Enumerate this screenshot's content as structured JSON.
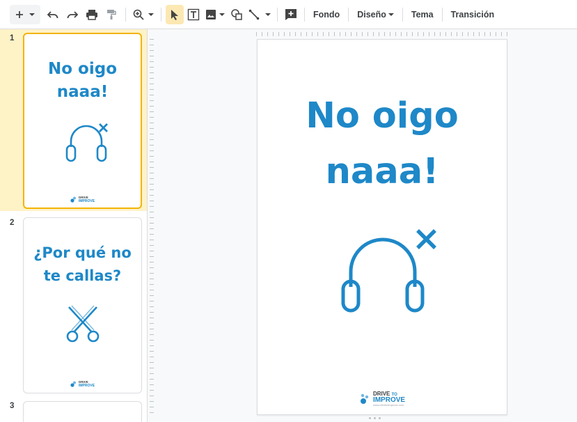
{
  "toolbar": {
    "new_icon": "plus-icon",
    "buttons": [
      "undo-icon",
      "redo-icon",
      "print-icon",
      "paint-format-icon",
      "zoom-icon",
      "select-icon",
      "textbox-icon",
      "image-icon",
      "shape-icon",
      "line-icon",
      "comment-icon"
    ],
    "fondo": "Fondo",
    "diseno": "Diseño",
    "tema": "Tema",
    "transicion": "Transición"
  },
  "slides": [
    {
      "number": "1",
      "title_line1": "No oigo",
      "title_line2": "naaa!",
      "icon": "headphones-icon"
    },
    {
      "number": "2",
      "title_line1": "¿Por qué no",
      "title_line2": "te callas?",
      "icon": "scissors-icon"
    },
    {
      "number": "3"
    }
  ],
  "main_slide": {
    "title_line1": "No oigo",
    "title_line2": "naaa!",
    "icon": "headphones-icon"
  },
  "logo": {
    "top": "DRIVE",
    "to": "TO",
    "bottom": "IMPROVE",
    "url": "www.drivetoimprove.com"
  },
  "colors": {
    "accent": "#1e88c8",
    "selection": "#fef2c7",
    "selection_border": "#f4b400"
  }
}
